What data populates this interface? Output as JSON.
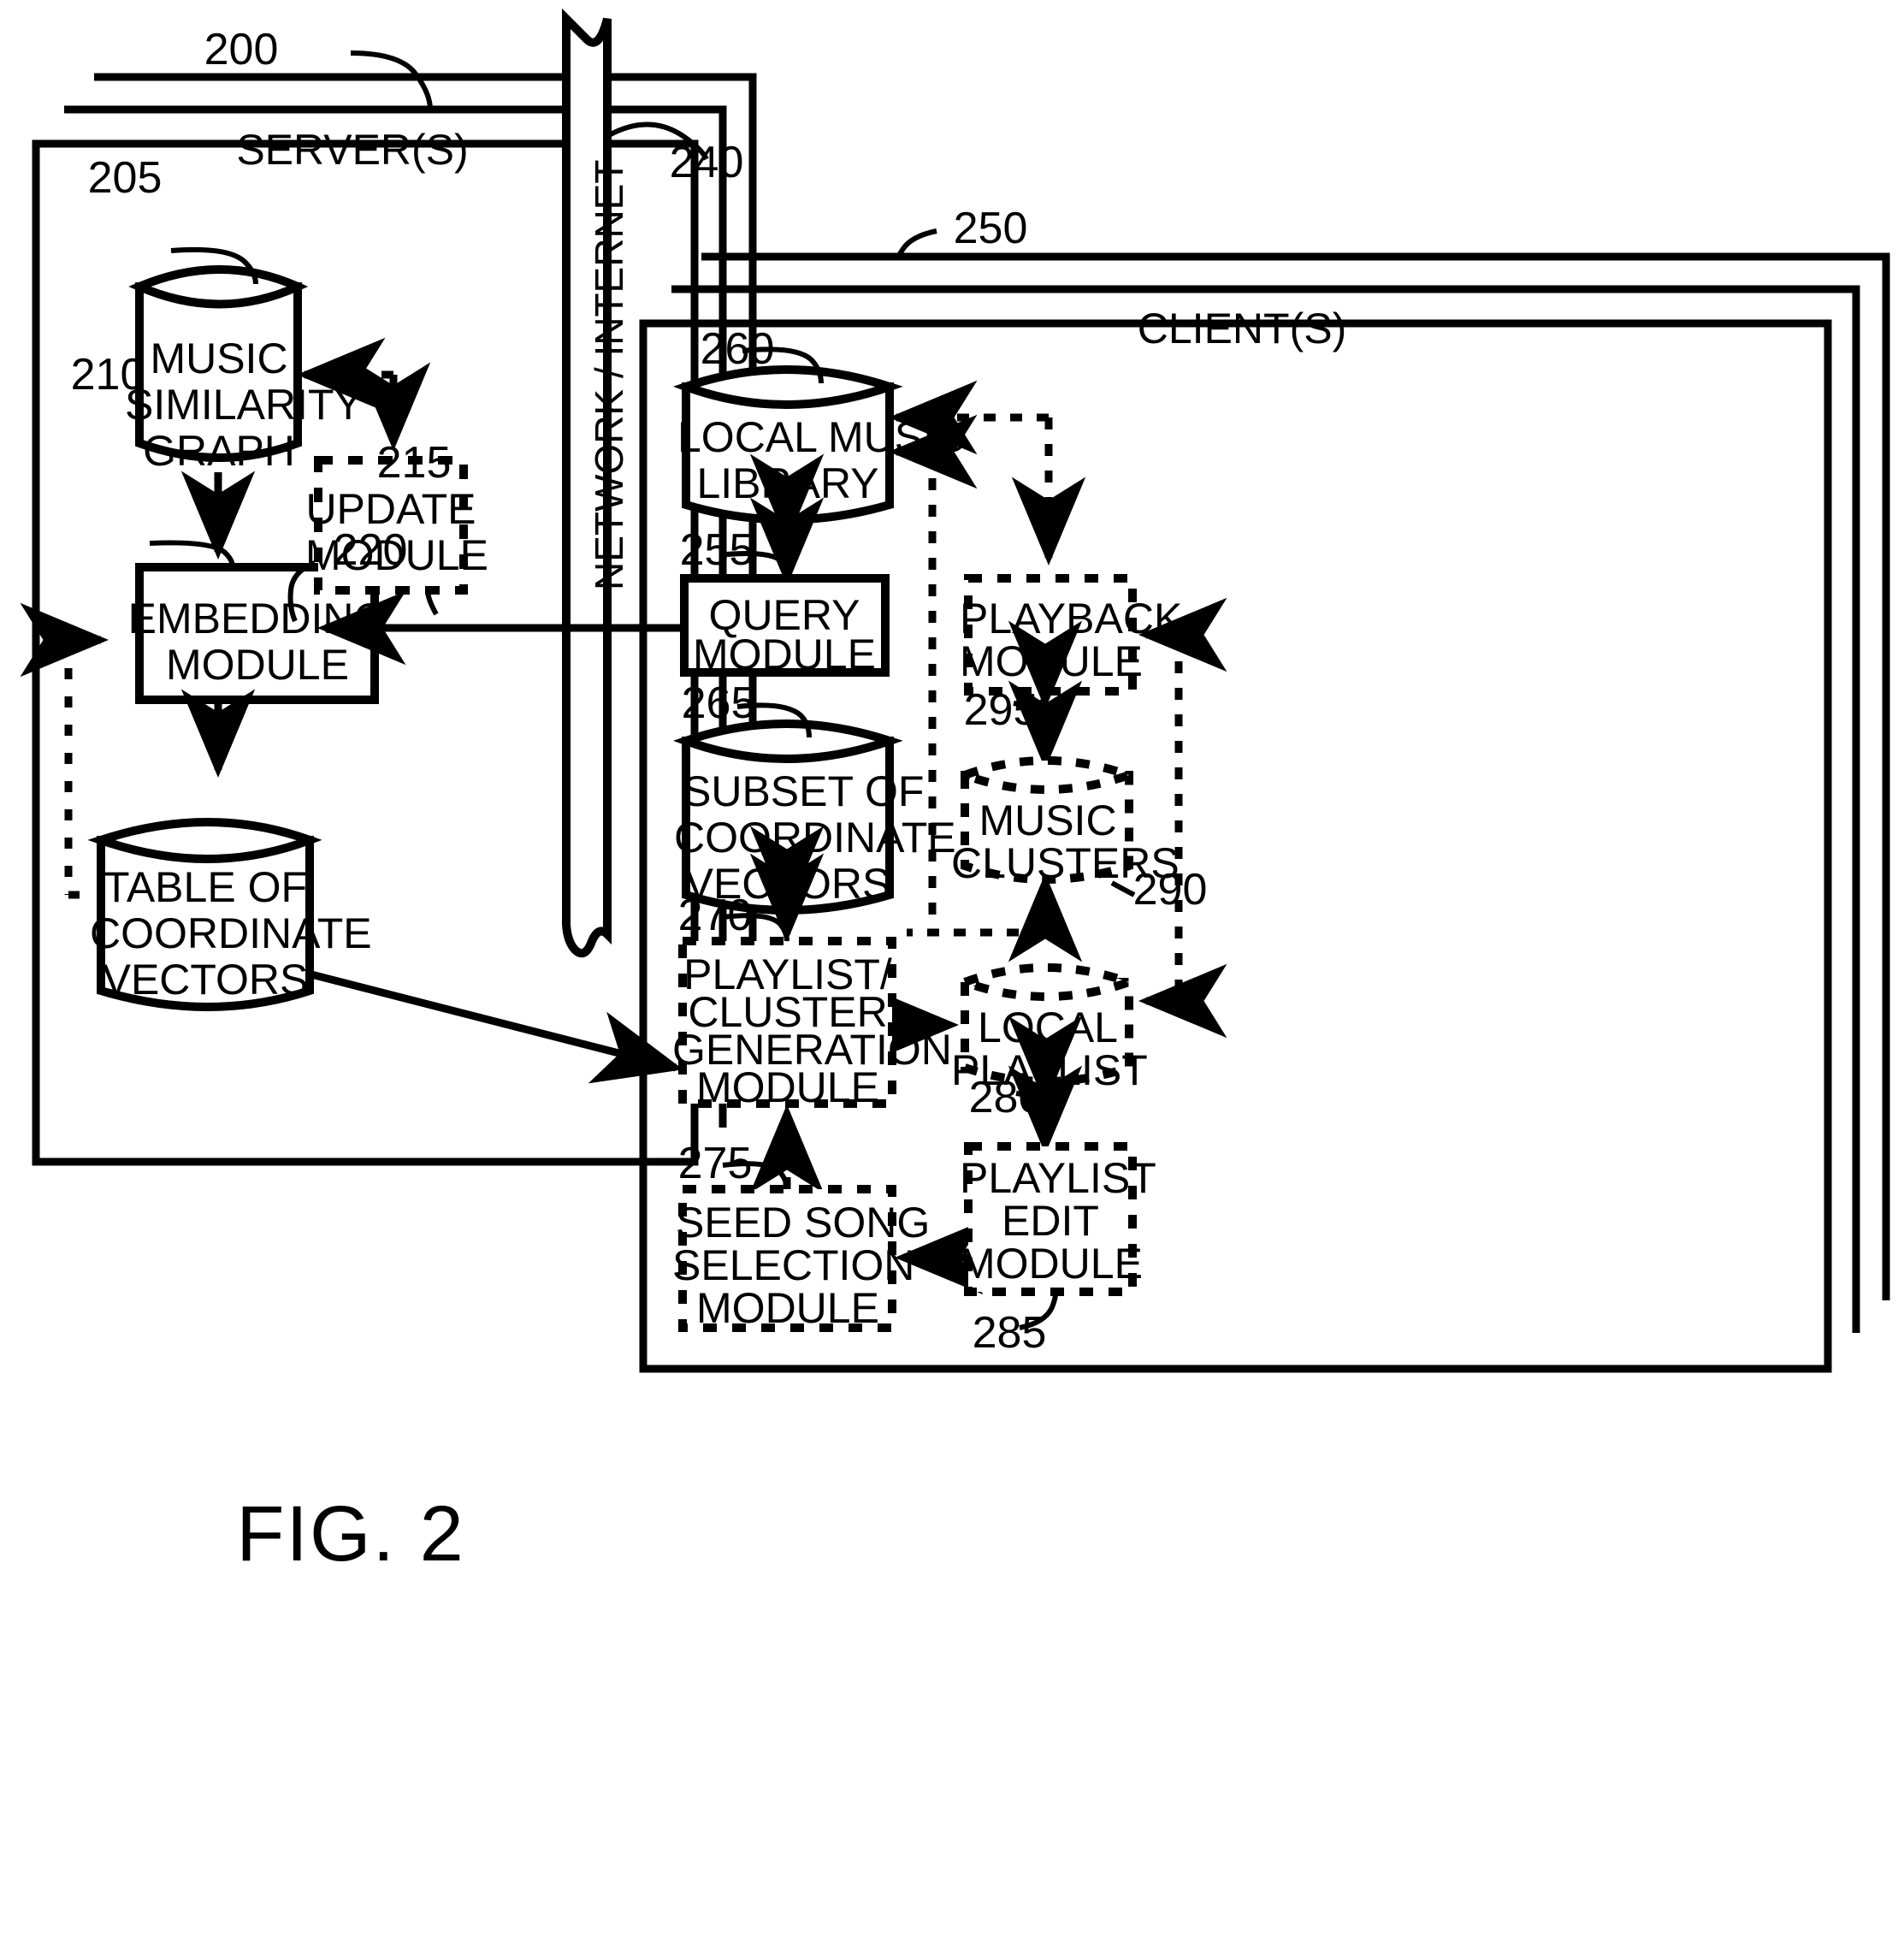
{
  "figure": {
    "caption": "FIG. 2"
  },
  "network": {
    "label": "NETWORK / INTERNET",
    "ref": "240"
  },
  "server_panel": {
    "title": "SERVER(S)",
    "ref": "200",
    "nodes": [
      {
        "id": "music_similarity_graph",
        "ref": "205",
        "label": "MUSIC\nSIMILARITY\nGRAPH",
        "shape": "cylinder",
        "stroke": "solid"
      },
      {
        "id": "embedding_module",
        "ref": "210",
        "label": "EMBEDDING\nMODULE",
        "shape": "box",
        "stroke": "solid"
      },
      {
        "id": "update_module",
        "ref": "215",
        "label": "UPDATE\nMODULE",
        "shape": "box",
        "stroke": "dashed"
      },
      {
        "id": "table_of_coordinate_vectors",
        "ref": "220",
        "label": "TABLE OF\nCOORDINATE\nVECTORS",
        "shape": "cylinder",
        "stroke": "solid"
      }
    ]
  },
  "client_panel": {
    "title": "CLIENT(S)",
    "ref": "250",
    "nodes": [
      {
        "id": "query_module",
        "ref": "255",
        "label": "QUERY\nMODULE",
        "shape": "box",
        "stroke": "solid"
      },
      {
        "id": "local_music_library",
        "ref": "260",
        "label": "LOCAL MUSIC\nLIBRARY",
        "shape": "cylinder",
        "stroke": "solid"
      },
      {
        "id": "subset_of_coordinate_vectors",
        "ref": "265",
        "label": "SUBSET OF\nCOORDINATE\nVECTORS",
        "shape": "cylinder",
        "stroke": "solid"
      },
      {
        "id": "playlist_cluster_generation_module",
        "ref": "270",
        "label": "PLAYLIST/\nCLUSTER\nGENERATION\nMODULE",
        "shape": "box",
        "stroke": "dashed"
      },
      {
        "id": "seed_song_selection_module",
        "ref": "275",
        "label": "SEED SONG\nSELECTION\nMODULE",
        "shape": "box",
        "stroke": "dashed"
      },
      {
        "id": "local_playlist",
        "ref": "280",
        "label": "LOCAL\nPLAYLIST",
        "shape": "cylinder",
        "stroke": "dashed"
      },
      {
        "id": "playlist_edit_module",
        "ref": "285",
        "label": "PLAYLIST\nEDIT\nMODULE",
        "shape": "box",
        "stroke": "dashed"
      },
      {
        "id": "music_clusters",
        "ref": "290",
        "label": "MUSIC\nCLUSTERS",
        "shape": "cylinder",
        "stroke": "dashed"
      },
      {
        "id": "playback_module",
        "ref": "295",
        "label": "PLAYBACK\nMODULE",
        "shape": "box",
        "stroke": "dashed"
      }
    ]
  },
  "labels": {
    "music_similarity_graph_l1": "MUSIC",
    "music_similarity_graph_l2": "SIMILARITY",
    "music_similarity_graph_l3": "GRAPH",
    "embedding_module_l1": "EMBEDDING",
    "embedding_module_l2": "MODULE",
    "update_module_l1": "UPDATE",
    "update_module_l2": "MODULE",
    "table_vectors_l1": "TABLE OF",
    "table_vectors_l2": "COORDINATE",
    "table_vectors_l3": "VECTORS",
    "local_music_library_l1": "LOCAL MUSIC",
    "local_music_library_l2": "LIBRARY",
    "query_module_l1": "QUERY",
    "query_module_l2": "MODULE",
    "playback_module_l1": "PLAYBACK",
    "playback_module_l2": "MODULE",
    "subset_vectors_l1": "SUBSET OF",
    "subset_vectors_l2": "COORDINATE",
    "subset_vectors_l3": "VECTORS",
    "music_clusters_l1": "MUSIC",
    "music_clusters_l2": "CLUSTERS",
    "playlist_gen_l1": "PLAYLIST/",
    "playlist_gen_l2": "CLUSTER",
    "playlist_gen_l3": "GENERATION",
    "playlist_gen_l4": "MODULE",
    "local_playlist_l1": "LOCAL",
    "local_playlist_l2": "PLAYLIST",
    "seed_song_l1": "SEED SONG",
    "seed_song_l2": "SELECTION",
    "seed_song_l3": "MODULE",
    "playlist_edit_l1": "PLAYLIST",
    "playlist_edit_l2": "EDIT",
    "playlist_edit_l3": "MODULE"
  },
  "refs": {
    "r200": "200",
    "r205": "205",
    "r210": "210",
    "r215": "215",
    "r220": "220",
    "r240": "240",
    "r250": "250",
    "r255": "255",
    "r260": "260",
    "r265": "265",
    "r270": "270",
    "r275": "275",
    "r280": "280",
    "r285": "285",
    "r290": "290",
    "r295": "295"
  },
  "style": {
    "ink": "#000000",
    "paper": "#ffffff"
  }
}
